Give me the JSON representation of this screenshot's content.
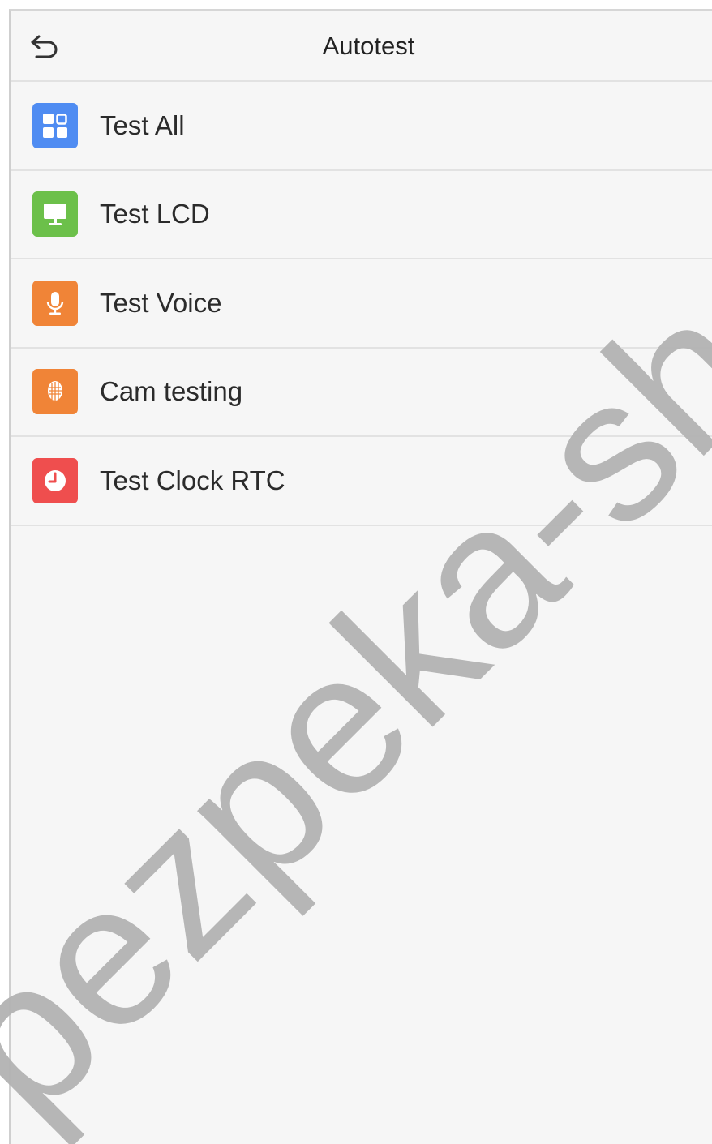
{
  "header": {
    "title": "Autotest",
    "back_icon": "back-arrow-icon"
  },
  "menu": {
    "items": [
      {
        "label": "Test All",
        "icon": "grid-apps-icon",
        "color": "#4f8cf2"
      },
      {
        "label": "Test LCD",
        "icon": "monitor-icon",
        "color": "#6cc04a"
      },
      {
        "label": "Test Voice",
        "icon": "microphone-icon",
        "color": "#f08437"
      },
      {
        "label": "Cam testing",
        "icon": "face-scan-icon",
        "color": "#f08437"
      },
      {
        "label": "Test Clock RTC",
        "icon": "clock-icon",
        "color": "#ef4e4e"
      }
    ]
  },
  "watermark": {
    "text": "pezpeka-shop",
    "color": "#b3b3b3"
  }
}
